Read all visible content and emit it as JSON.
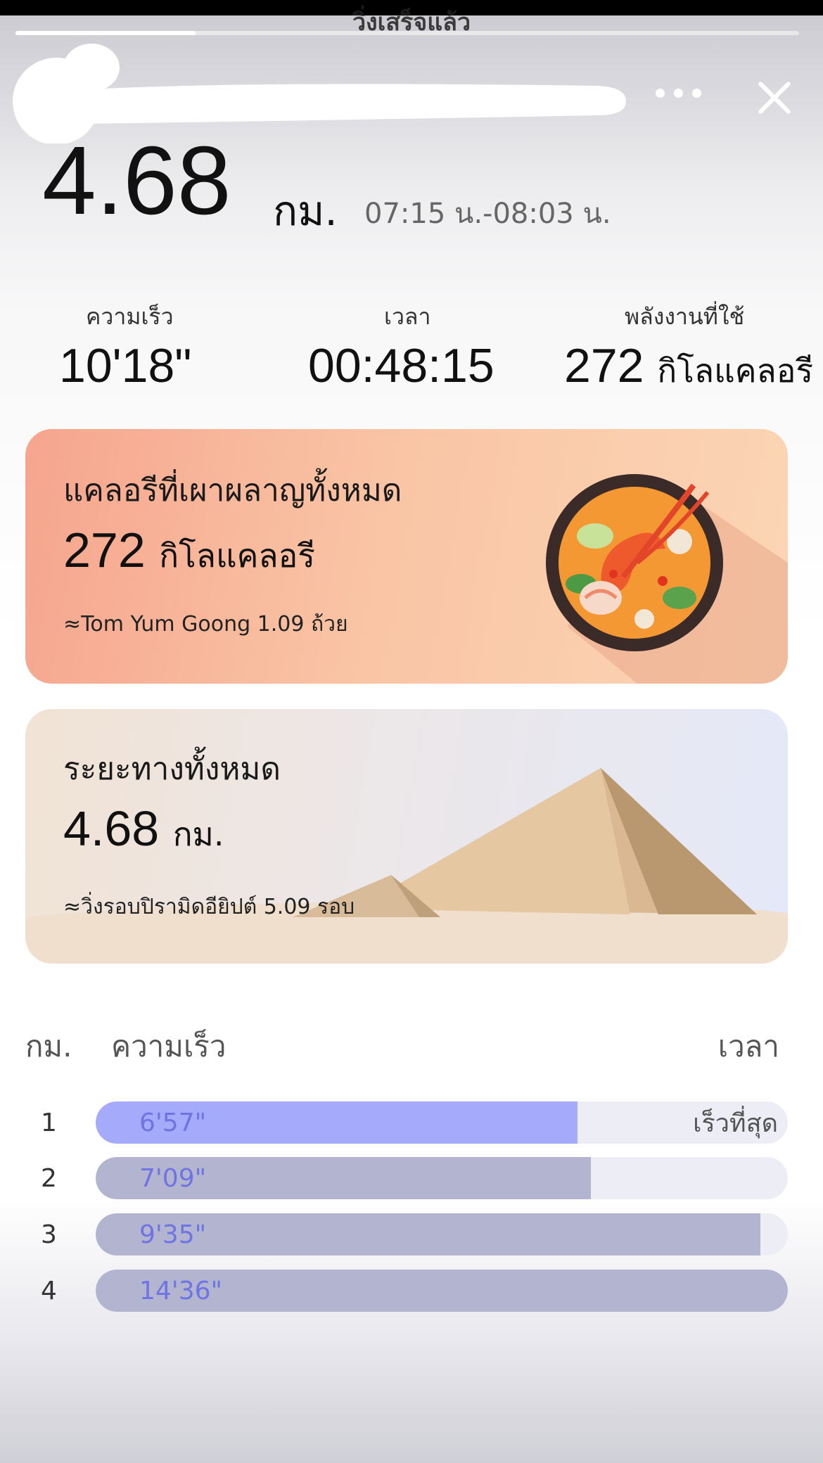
{
  "header": {
    "title_peek": "วิ่งเสร็จแล้ว",
    "progress": 0.23
  },
  "summary": {
    "distance": "4.68",
    "distance_unit": "กม.",
    "time_range": "07:15 น.-08:03 น."
  },
  "stats": [
    {
      "label": "ความเร็ว",
      "value": "10'18\"",
      "unit": ""
    },
    {
      "label": "เวลา",
      "value": "00:48:15",
      "unit": ""
    },
    {
      "label": "พลังงานที่ใช้",
      "value": "272",
      "unit": "กิโลแคลอรี"
    }
  ],
  "calorie_card": {
    "title": "แคลอรีที่เผาผลาญทั้งหมด",
    "value": "272",
    "unit": "กิโลแคลอรี",
    "note": "≈Tom Yum Goong 1.09 ถ้วย",
    "icon": "tom-yum-bowl-icon"
  },
  "distance_card": {
    "title": "ระยะทางทั้งหมด",
    "value": "4.68",
    "unit": "กม.",
    "note": "≈วิ่งรอบปิรามิดอียิปต์ 5.09 รอบ",
    "icon": "pyramids-icon"
  },
  "splits": {
    "col_km": "กม.",
    "col_pace": "ความเร็ว",
    "col_time": "เวลา",
    "fastest_label": "เร็วที่สุด",
    "rows": [
      {
        "km": "1",
        "pace": "6'57\"",
        "fraction": 0.696,
        "fastest": true
      },
      {
        "km": "2",
        "pace": "7'09\"",
        "fraction": 0.715,
        "fastest": false
      },
      {
        "km": "3",
        "pace": "9'35\"",
        "fraction": 0.96,
        "fastest": false
      },
      {
        "km": "4",
        "pace": "14'36\"",
        "fraction": 1.0,
        "fastest": false
      }
    ]
  },
  "colors": {
    "fastest_bar": "#a6aafb",
    "normal_bar": "#b2b4d0",
    "pace_text": "#6f74e3"
  }
}
